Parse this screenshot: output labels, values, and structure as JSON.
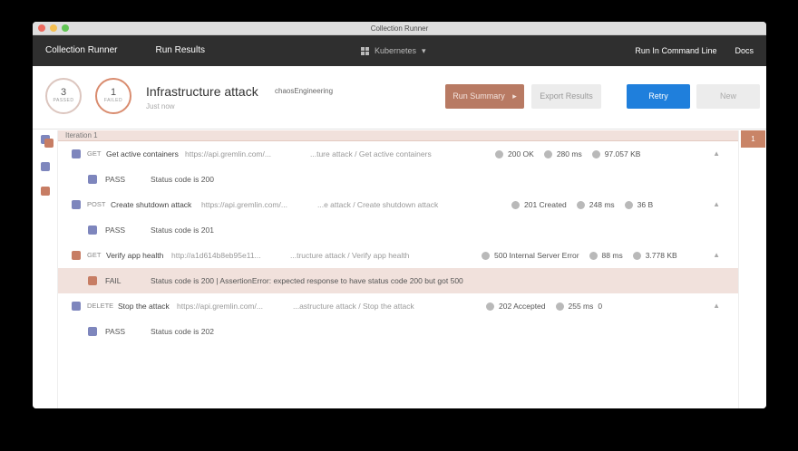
{
  "window": {
    "title": "Collection Runner"
  },
  "nav": {
    "left": [
      "Collection Runner",
      "Run Results"
    ],
    "environment": "Kubernetes",
    "right": [
      "Run In Command Line",
      "Docs"
    ]
  },
  "summary": {
    "passed_count": "3",
    "passed_label": "PASSED",
    "failed_count": "1",
    "failed_label": "FAILED",
    "title": "Infrastructure attack",
    "tag": "chaosEngineering",
    "time": "Just now",
    "buttons": {
      "run_summary": "Run Summary",
      "export": "Export Results",
      "retry": "Retry",
      "new": "New"
    }
  },
  "colors": {
    "pass": "#7e86bd",
    "fail": "#c77d64",
    "retry": "#1f7fdc"
  },
  "iteration": "Iteration 1",
  "requests": [
    {
      "method": "GET",
      "name": "Get active containers",
      "url": "https://api.gremlin.com/...",
      "path": "...ture attack / Get active containers",
      "code": "200 OK",
      "time": "280 ms",
      "size": "97.057 KB",
      "test": {
        "status": "PASS",
        "desc": "Status code is 200"
      }
    },
    {
      "method": "POST",
      "name": "Create shutdown attack",
      "url": "https://api.gremlin.com/...",
      "path": "...e attack / Create shutdown attack",
      "code": "201 Created",
      "time": "248 ms",
      "size": "36 B",
      "test": {
        "status": "PASS",
        "desc": "Status code is 201"
      }
    },
    {
      "method": "GET",
      "name": "Verify app health",
      "url": "http://a1d614b8eb95e11...",
      "path": "...tructure attack / Verify app health",
      "code": "500 Internal Server Error",
      "time": "88 ms",
      "size": "3.778 KB",
      "test": {
        "status": "FAIL",
        "desc": "Status code is 200 | AssertionError: expected response to have status code 200 but got 500"
      }
    },
    {
      "method": "DELETE",
      "name": "Stop the attack",
      "url": "https://api.gremlin.com/...",
      "path": "...astructure attack / Stop the attack",
      "code": "202 Accepted",
      "time": "255 ms",
      "size": "0",
      "test": {
        "status": "PASS",
        "desc": "Status code is 202"
      }
    }
  ]
}
